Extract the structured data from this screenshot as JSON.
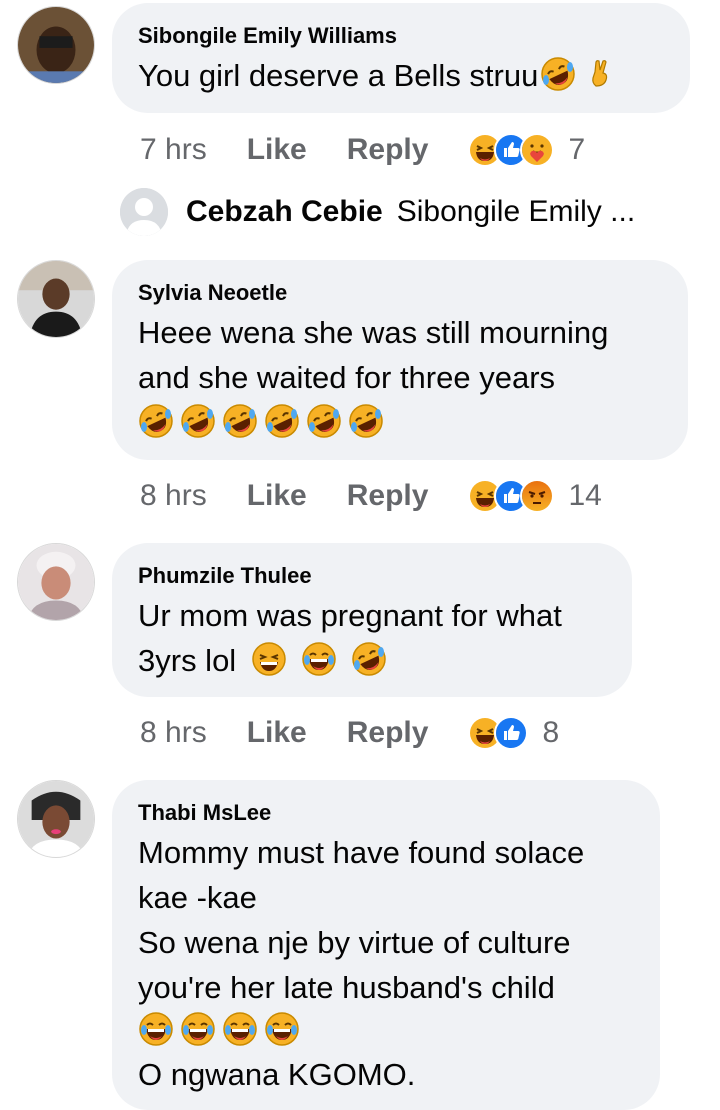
{
  "comments": [
    {
      "author": "Sibongile Emily Williams",
      "lines": [
        "You girl deserve a Bells struu"
      ],
      "time": "7 hrs",
      "like": "Like",
      "reply": "Reply",
      "reaction_count": "7",
      "reactions": [
        "haha",
        "like",
        "care"
      ]
    },
    {
      "author": "Sylvia Neoetle",
      "lines": [
        "Heee wena she was still mourning",
        "and she waited for three years"
      ],
      "time": "8 hrs",
      "like": "Like",
      "reply": "Reply",
      "reaction_count": "14",
      "reactions": [
        "haha",
        "like",
        "angry"
      ]
    },
    {
      "author": "Phumzile Thulee",
      "lines": [
        "Ur mom was pregnant for what",
        "3yrs lol"
      ],
      "time": "8 hrs",
      "like": "Like",
      "reply": "Reply",
      "reaction_count": "8",
      "reactions": [
        "haha",
        "like"
      ]
    },
    {
      "author": "Thabi MsLee",
      "lines": [
        "Mommy must have found solace",
        "kae -kae",
        "So wena nje by virtue of culture",
        "you're her late husband's child",
        "",
        "O ngwana KGOMO."
      ]
    }
  ],
  "reply_preview": {
    "author": "Cebzah Cebie",
    "text": "Sibongile Emily ..."
  },
  "colors": {
    "bubble": "#f0f2f5",
    "meta": "#65676b",
    "like_blue": "#1877f2",
    "emoji_yellow": "#f7b125",
    "angry_orange": "#e9710f"
  }
}
